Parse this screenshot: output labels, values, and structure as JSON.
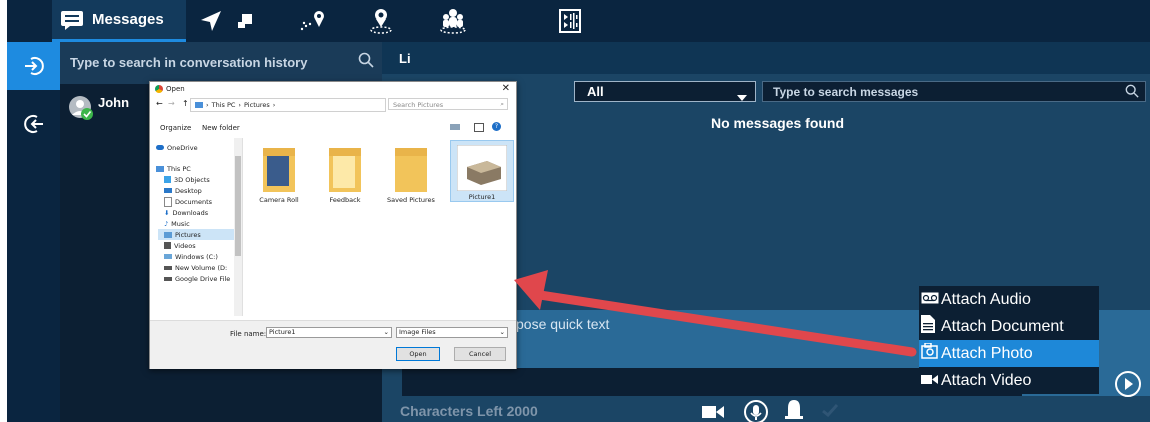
{
  "topbar": {
    "messages_tab_label": "Messages"
  },
  "conversations": {
    "search_placeholder": "Type to search in conversation history",
    "contacts": [
      {
        "name": "John"
      }
    ]
  },
  "chat": {
    "contact_name": "Li",
    "filter_selected": "All",
    "search_placeholder": "Type to search messages",
    "empty_text": "No messages found",
    "compose_placeholder_visible": "pose quick text",
    "characters_left": "Characters Left 2000"
  },
  "attach_menu": {
    "items": [
      {
        "label": "Attach Audio",
        "icon": "voicemail-icon"
      },
      {
        "label": "Attach Document",
        "icon": "document-icon"
      },
      {
        "label": "Attach Photo",
        "icon": "photo-icon",
        "highlighted": true
      },
      {
        "label": "Attach Video",
        "icon": "video-icon"
      }
    ],
    "highlight_color": "#1e88d8"
  },
  "file_dialog": {
    "title": "Open",
    "breadcrumb": [
      "This PC",
      "Pictures"
    ],
    "search_placeholder": "Search Pictures",
    "toolbar": {
      "organize": "Organize",
      "new_folder": "New folder"
    },
    "tree": [
      "OneDrive",
      "This PC",
      "3D Objects",
      "Desktop",
      "Documents",
      "Downloads",
      "Music",
      "Pictures",
      "Videos",
      "Windows (C:)",
      "New Volume (D:",
      "Google Drive File"
    ],
    "folders": [
      "Camera Roll",
      "Feedback",
      "Saved Pictures",
      "Picture1"
    ],
    "filename_label": "File name:",
    "filename_value": "Picture1",
    "filetype": "Image Files",
    "open_button": "Open",
    "cancel_button": "Cancel"
  },
  "colors": {
    "app_bg": "#0f3554",
    "accent": "#1e8be0",
    "annotation_arrow": "#e0474c"
  }
}
